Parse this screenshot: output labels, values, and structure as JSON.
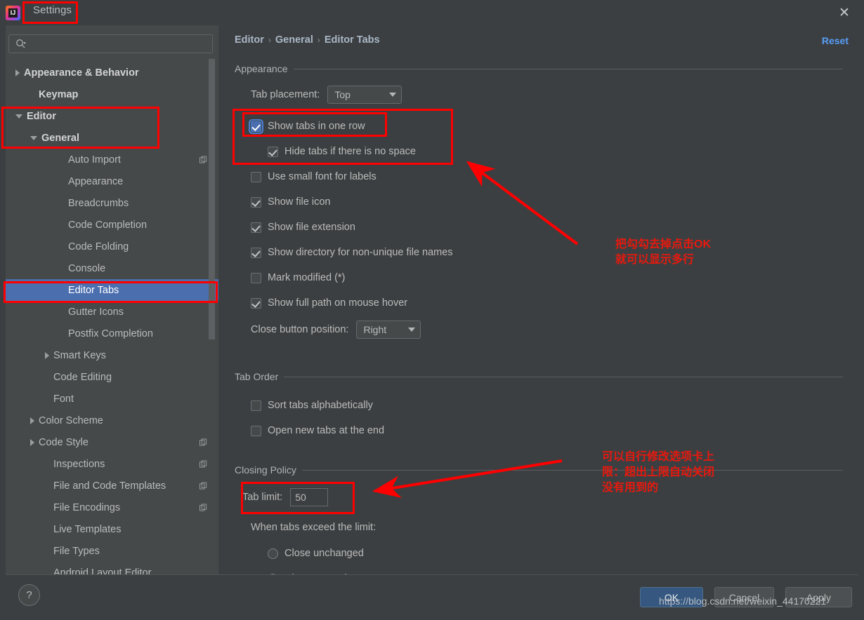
{
  "window": {
    "title": "Settings",
    "app_icon": "intellij-idea-icon",
    "close_icon": "close-icon"
  },
  "search": {
    "placeholder": "",
    "value": "",
    "icon": "search-icon"
  },
  "sidebar": {
    "items": [
      {
        "label": "Appearance & Behavior",
        "indent": 0,
        "twisty": "right",
        "bold": true,
        "selected": false,
        "copy": false
      },
      {
        "label": "Keymap",
        "indent": 1,
        "twisty": "none",
        "bold": true,
        "selected": false,
        "copy": false
      },
      {
        "label": "Editor",
        "indent": 0,
        "twisty": "down",
        "bold": true,
        "selected": false,
        "copy": false
      },
      {
        "label": "General",
        "indent": 1,
        "twisty": "down",
        "bold": true,
        "selected": false,
        "copy": false
      },
      {
        "label": "Auto Import",
        "indent": 3,
        "twisty": "none",
        "bold": false,
        "selected": false,
        "copy": true
      },
      {
        "label": "Appearance",
        "indent": 3,
        "twisty": "none",
        "bold": false,
        "selected": false,
        "copy": false
      },
      {
        "label": "Breadcrumbs",
        "indent": 3,
        "twisty": "none",
        "bold": false,
        "selected": false,
        "copy": false
      },
      {
        "label": "Code Completion",
        "indent": 3,
        "twisty": "none",
        "bold": false,
        "selected": false,
        "copy": false
      },
      {
        "label": "Code Folding",
        "indent": 3,
        "twisty": "none",
        "bold": false,
        "selected": false,
        "copy": false
      },
      {
        "label": "Console",
        "indent": 3,
        "twisty": "none",
        "bold": false,
        "selected": false,
        "copy": false
      },
      {
        "label": "Editor Tabs",
        "indent": 3,
        "twisty": "none",
        "bold": false,
        "selected": true,
        "copy": false
      },
      {
        "label": "Gutter Icons",
        "indent": 3,
        "twisty": "none",
        "bold": false,
        "selected": false,
        "copy": false
      },
      {
        "label": "Postfix Completion",
        "indent": 3,
        "twisty": "none",
        "bold": false,
        "selected": false,
        "copy": false
      },
      {
        "label": "Smart Keys",
        "indent": 2,
        "twisty": "right",
        "bold": false,
        "selected": false,
        "copy": false
      },
      {
        "label": "Code Editing",
        "indent": 2,
        "twisty": "none",
        "bold": false,
        "selected": false,
        "copy": false
      },
      {
        "label": "Font",
        "indent": 2,
        "twisty": "none",
        "bold": false,
        "selected": false,
        "copy": false
      },
      {
        "label": "Color Scheme",
        "indent": 1,
        "twisty": "right",
        "bold": false,
        "selected": false,
        "copy": false
      },
      {
        "label": "Code Style",
        "indent": 1,
        "twisty": "right",
        "bold": false,
        "selected": false,
        "copy": true
      },
      {
        "label": "Inspections",
        "indent": 2,
        "twisty": "none",
        "bold": false,
        "selected": false,
        "copy": true
      },
      {
        "label": "File and Code Templates",
        "indent": 2,
        "twisty": "none",
        "bold": false,
        "selected": false,
        "copy": true
      },
      {
        "label": "File Encodings",
        "indent": 2,
        "twisty": "none",
        "bold": false,
        "selected": false,
        "copy": true
      },
      {
        "label": "Live Templates",
        "indent": 2,
        "twisty": "none",
        "bold": false,
        "selected": false,
        "copy": false
      },
      {
        "label": "File Types",
        "indent": 2,
        "twisty": "none",
        "bold": false,
        "selected": false,
        "copy": false
      },
      {
        "label": "Android Layout Editor",
        "indent": 2,
        "twisty": "none",
        "bold": false,
        "selected": false,
        "copy": false
      }
    ]
  },
  "breadcrumb": {
    "parts": [
      "Editor",
      "General",
      "Editor Tabs"
    ],
    "separator": "›"
  },
  "reset": {
    "label": "Reset"
  },
  "appearance": {
    "group_title": "Appearance",
    "tab_placement": {
      "label": "Tab placement:",
      "value": "Top"
    },
    "checkboxes": [
      {
        "label": "Show tabs in one row",
        "checked": true,
        "indent": 0,
        "focused": true
      },
      {
        "label": "Hide tabs if there is no space",
        "checked": true,
        "indent": 1,
        "focused": false
      },
      {
        "label": "Use small font for labels",
        "checked": false,
        "indent": 0,
        "focused": false
      },
      {
        "label": "Show file icon",
        "checked": true,
        "indent": 0,
        "focused": false
      },
      {
        "label": "Show file extension",
        "checked": true,
        "indent": 0,
        "focused": false
      },
      {
        "label": "Show directory for non-unique file names",
        "checked": true,
        "indent": 0,
        "focused": false
      },
      {
        "label": "Mark modified (*)",
        "checked": false,
        "indent": 0,
        "focused": false
      },
      {
        "label": "Show full path on mouse hover",
        "checked": true,
        "indent": 0,
        "focused": false
      }
    ],
    "close_button_position": {
      "label": "Close button position:",
      "value": "Right"
    }
  },
  "tab_order": {
    "group_title": "Tab Order",
    "checkboxes": [
      {
        "label": "Sort tabs alphabetically",
        "checked": false
      },
      {
        "label": "Open new tabs at the end",
        "checked": false
      }
    ]
  },
  "closing_policy": {
    "group_title": "Closing Policy",
    "tab_limit": {
      "label": "Tab limit:",
      "value": "50"
    },
    "when_exceed_label": "When tabs exceed the limit:",
    "radios": [
      {
        "label": "Close unchanged",
        "selected": false
      },
      {
        "label": "Close unused",
        "selected": true
      }
    ]
  },
  "footer": {
    "help_label": "?",
    "ok_label": "OK",
    "cancel_label": "Cancel",
    "apply_label": "Apply",
    "watermark": "https://blog.csdn.net/weixin_44170221"
  },
  "annotations": {
    "color": "#ff0000",
    "text_color": "#e8190e",
    "note_one": "把勾勾去掉点击OK\n就可以显示多行",
    "note_two": "可以自行修改选项卡上\n限：超出上限自动关闭\n没有用到的"
  }
}
